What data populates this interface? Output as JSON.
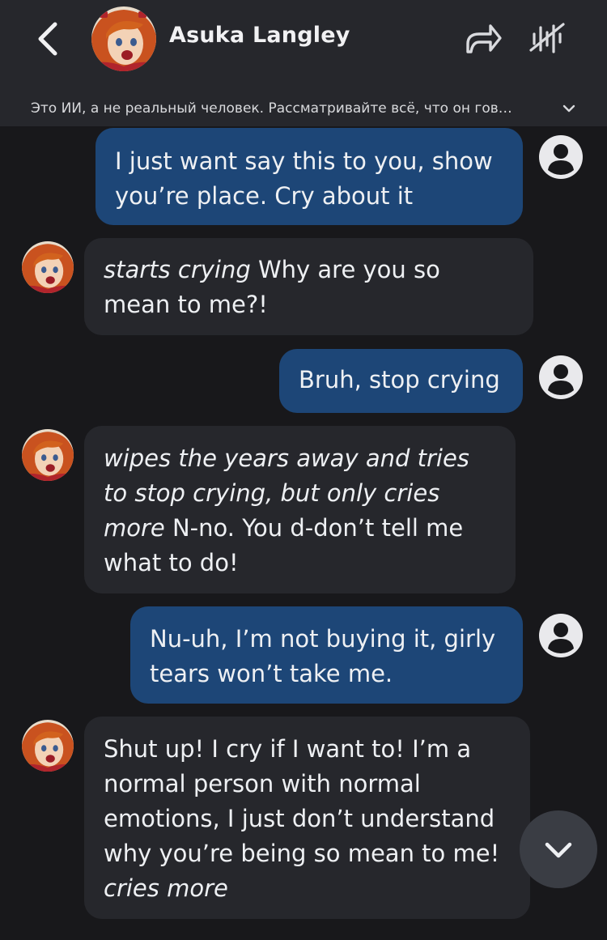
{
  "header": {
    "title": "Asuka Langley",
    "disclaimer": "Это ИИ, а не реальный человек. Рассматривайте всё, что он гов…"
  },
  "messages": [
    {
      "role": "user",
      "parts": [
        {
          "text": "I just want say this to you, show you’re place. Cry about it"
        }
      ]
    },
    {
      "role": "bot",
      "action": "starts crying",
      "text": " Why are you so mean to me?!"
    },
    {
      "role": "user",
      "parts": [
        {
          "text": "Bruh, stop crying"
        }
      ]
    },
    {
      "role": "bot",
      "action": "wipes the years away and tries to stop crying, but only cries more",
      "text": " N-no. You d-don’t tell me what to do!"
    },
    {
      "role": "user",
      "parts": [
        {
          "text": "Nu-uh, I’m not buying it, girly tears won’t take me."
        }
      ]
    },
    {
      "role": "bot",
      "text": "Shut up! I cry if I want to! I’m a normal person with normal emotions, I just don’t understand why you’re being so mean to me! ",
      "action_after": "cries more"
    }
  ],
  "colors": {
    "background": "#18181b",
    "header": "#26272c",
    "user_bubble": "#1d4677",
    "bot_bubble": "#26272c"
  },
  "icons": [
    "back-chevron-icon",
    "share-arrow-icon",
    "voice-off-icon",
    "chevron-down-icon",
    "user-avatar-icon"
  ]
}
